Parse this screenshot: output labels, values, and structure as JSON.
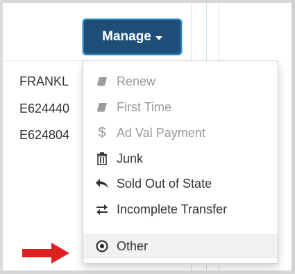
{
  "manage_button": {
    "label": "Manage"
  },
  "rows": [
    {
      "text": "FRANKL"
    },
    {
      "text": "E624440"
    },
    {
      "text": "E624804"
    }
  ],
  "menu": {
    "items": [
      {
        "label": "Renew",
        "icon": "book-icon",
        "disabled": true
      },
      {
        "label": "First Time",
        "icon": "book-icon",
        "disabled": true
      },
      {
        "label": "Ad Val Payment",
        "icon": "dollar-icon",
        "disabled": true
      },
      {
        "label": "Junk",
        "icon": "trash-icon",
        "disabled": false
      },
      {
        "label": "Sold Out of State",
        "icon": "reply-arrow-icon",
        "disabled": false
      },
      {
        "label": "Incomplete Transfer",
        "icon": "exchange-icon",
        "disabled": false
      },
      {
        "label": "Other",
        "icon": "target-circle-icon",
        "disabled": false,
        "highlighted": true
      }
    ]
  },
  "colors": {
    "button_bg": "#1f4e79",
    "button_border": "#2e86c1",
    "disabled_text": "#9a9a9a",
    "annotation_arrow": "#e02020"
  }
}
